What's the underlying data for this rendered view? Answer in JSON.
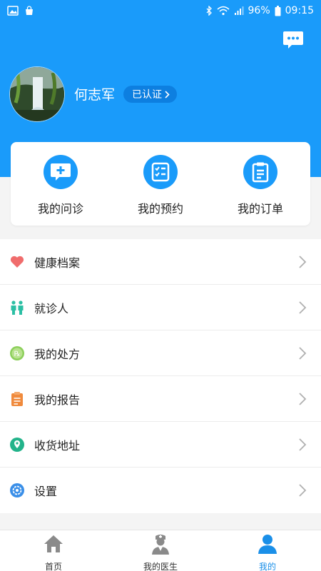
{
  "status_bar": {
    "battery": "96%",
    "time": "09:15"
  },
  "profile": {
    "name": "何志军",
    "verified_label": "已认证"
  },
  "quick_actions": [
    {
      "label": "我的问诊",
      "icon": "consult-icon"
    },
    {
      "label": "我的预约",
      "icon": "appointment-icon"
    },
    {
      "label": "我的订单",
      "icon": "order-icon"
    }
  ],
  "menu": [
    {
      "label": "健康档案",
      "icon": "heart-icon",
      "color": "#f06c6c"
    },
    {
      "label": "就诊人",
      "icon": "people-icon",
      "color": "#2bbfa4"
    },
    {
      "label": "我的处方",
      "icon": "prescription-icon",
      "color": "#8ccf5a"
    },
    {
      "label": "我的报告",
      "icon": "report-icon",
      "color": "#f08a3c"
    },
    {
      "label": "收货地址",
      "icon": "location-icon",
      "color": "#22b38a"
    },
    {
      "label": "设置",
      "icon": "settings-icon",
      "color": "#3a8fe8"
    }
  ],
  "tabs": [
    {
      "label": "首页",
      "icon": "home-icon",
      "active": false
    },
    {
      "label": "我的医生",
      "icon": "doctor-icon",
      "active": false
    },
    {
      "label": "我的",
      "icon": "user-icon",
      "active": true
    }
  ],
  "colors": {
    "primary": "#1a9bfa",
    "active_tab": "#1a8fe8"
  }
}
